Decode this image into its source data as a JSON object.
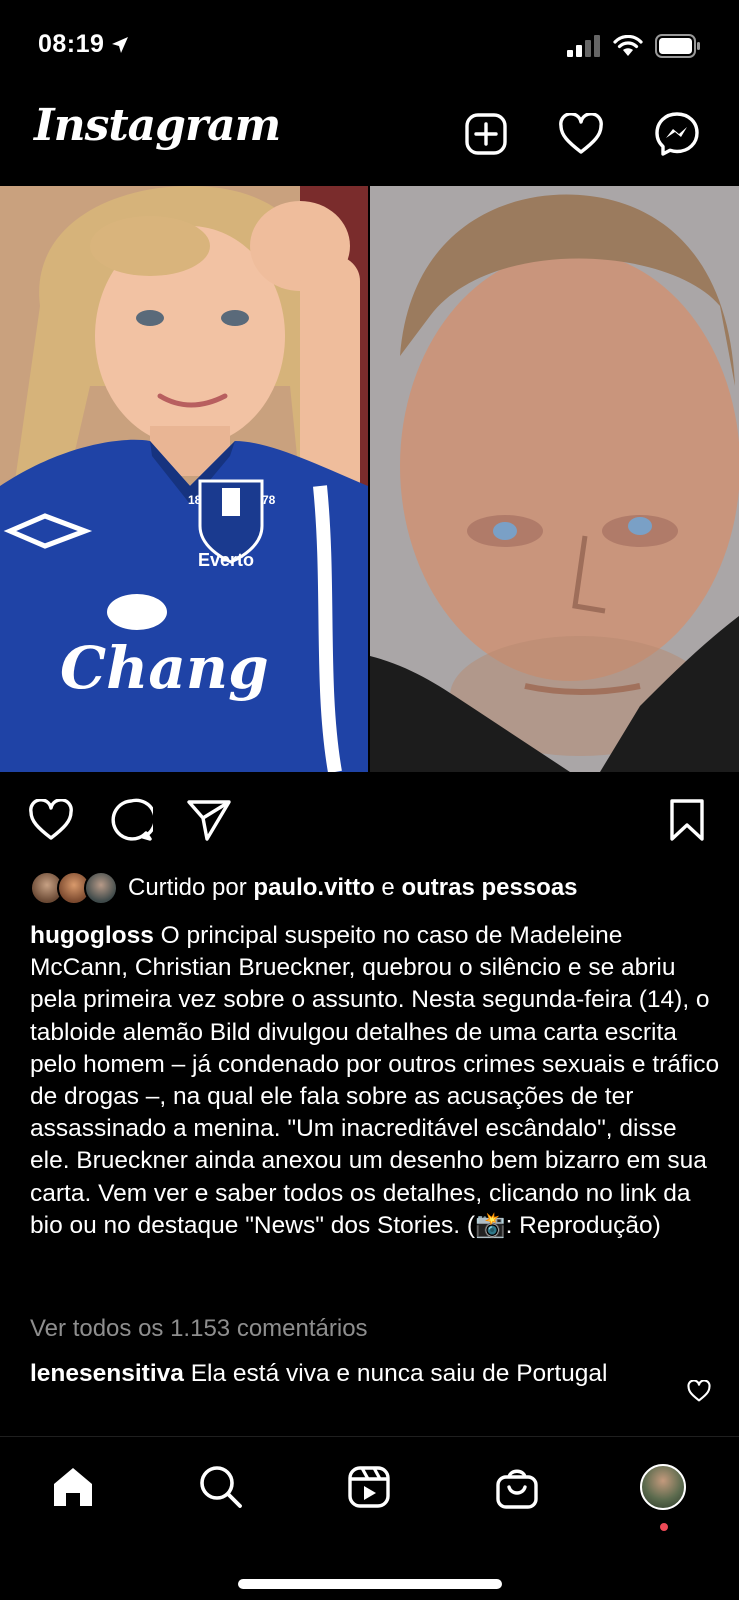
{
  "status_bar": {
    "time": "08:19"
  },
  "header": {
    "logo_text": "Instagram"
  },
  "post": {
    "liked_by": {
      "prefix": "Curtido por",
      "user": "paulo.vitto",
      "connector": "e",
      "others": "outras pessoas"
    },
    "caption": {
      "username": "hugogloss",
      "text_before_emoji": "O principal suspeito no caso de Madeleine McCann, Christian Brueckner, quebrou o silêncio e se abriu pela primeira vez sobre o assunto. Nesta segunda-feira (14), o tabloide alemão Bild divulgou detalhes de uma carta escrita pelo homem – já condenado por outros crimes sexuais e tráfico de drogas –, na qual ele fala sobre as acusações de ter assassinado a menina. \"Um inacreditável escândalo\", disse ele. Brueckner ainda anexou um desenho bem bizarro em sua carta. Vem ver e saber todos os detalhes, clicando no link da bio ou no destaque \"News\" dos Stories. (",
      "emoji": "📸",
      "text_after_emoji": ": Reprodução)"
    },
    "view_comments": "Ver todos os 1.153 comentários",
    "top_comment": {
      "username": "lenesensitiva",
      "text": "Ela está viva e nunca saiu de Portugal"
    }
  },
  "colors": {
    "background": "#000000",
    "text": "#ffffff",
    "muted": "#8e8e8e",
    "notification_dot": "#ed4956",
    "shirt_blue": "#1f43a6"
  },
  "icons": [
    "location-arrow-icon",
    "signal-icon",
    "wifi-icon",
    "battery-icon",
    "new-post-icon",
    "heart-icon",
    "messenger-icon",
    "like-icon",
    "comment-icon",
    "share-icon",
    "bookmark-icon",
    "home-icon",
    "search-icon",
    "reels-icon",
    "shop-icon",
    "profile-avatar"
  ]
}
